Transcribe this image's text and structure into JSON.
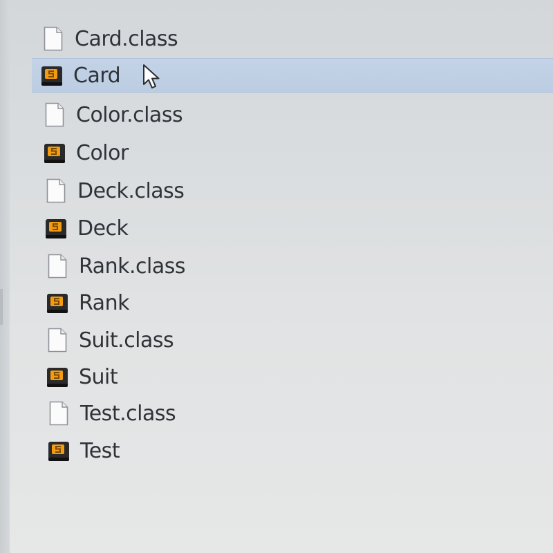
{
  "files": [
    {
      "name": "Card.class",
      "icon": "class-file-icon"
    },
    {
      "name": "Card",
      "icon": "sublime-file-icon",
      "selected": true
    },
    {
      "name": "Color.class",
      "icon": "class-file-icon"
    },
    {
      "name": "Color",
      "icon": "sublime-file-icon"
    },
    {
      "name": "Deck.class",
      "icon": "class-file-icon"
    },
    {
      "name": "Deck",
      "icon": "sublime-file-icon"
    },
    {
      "name": "Rank.class",
      "icon": "class-file-icon"
    },
    {
      "name": "Rank",
      "icon": "sublime-file-icon"
    },
    {
      "name": "Suit.class",
      "icon": "class-file-icon"
    },
    {
      "name": "Suit",
      "icon": "sublime-file-icon"
    },
    {
      "name": "Test.class",
      "icon": "class-file-icon"
    },
    {
      "name": "Test",
      "icon": "sublime-file-icon"
    }
  ],
  "colors": {
    "selection": "#c4d3e6",
    "text": "#2f3338",
    "sublime_orange": "#f39c12"
  }
}
